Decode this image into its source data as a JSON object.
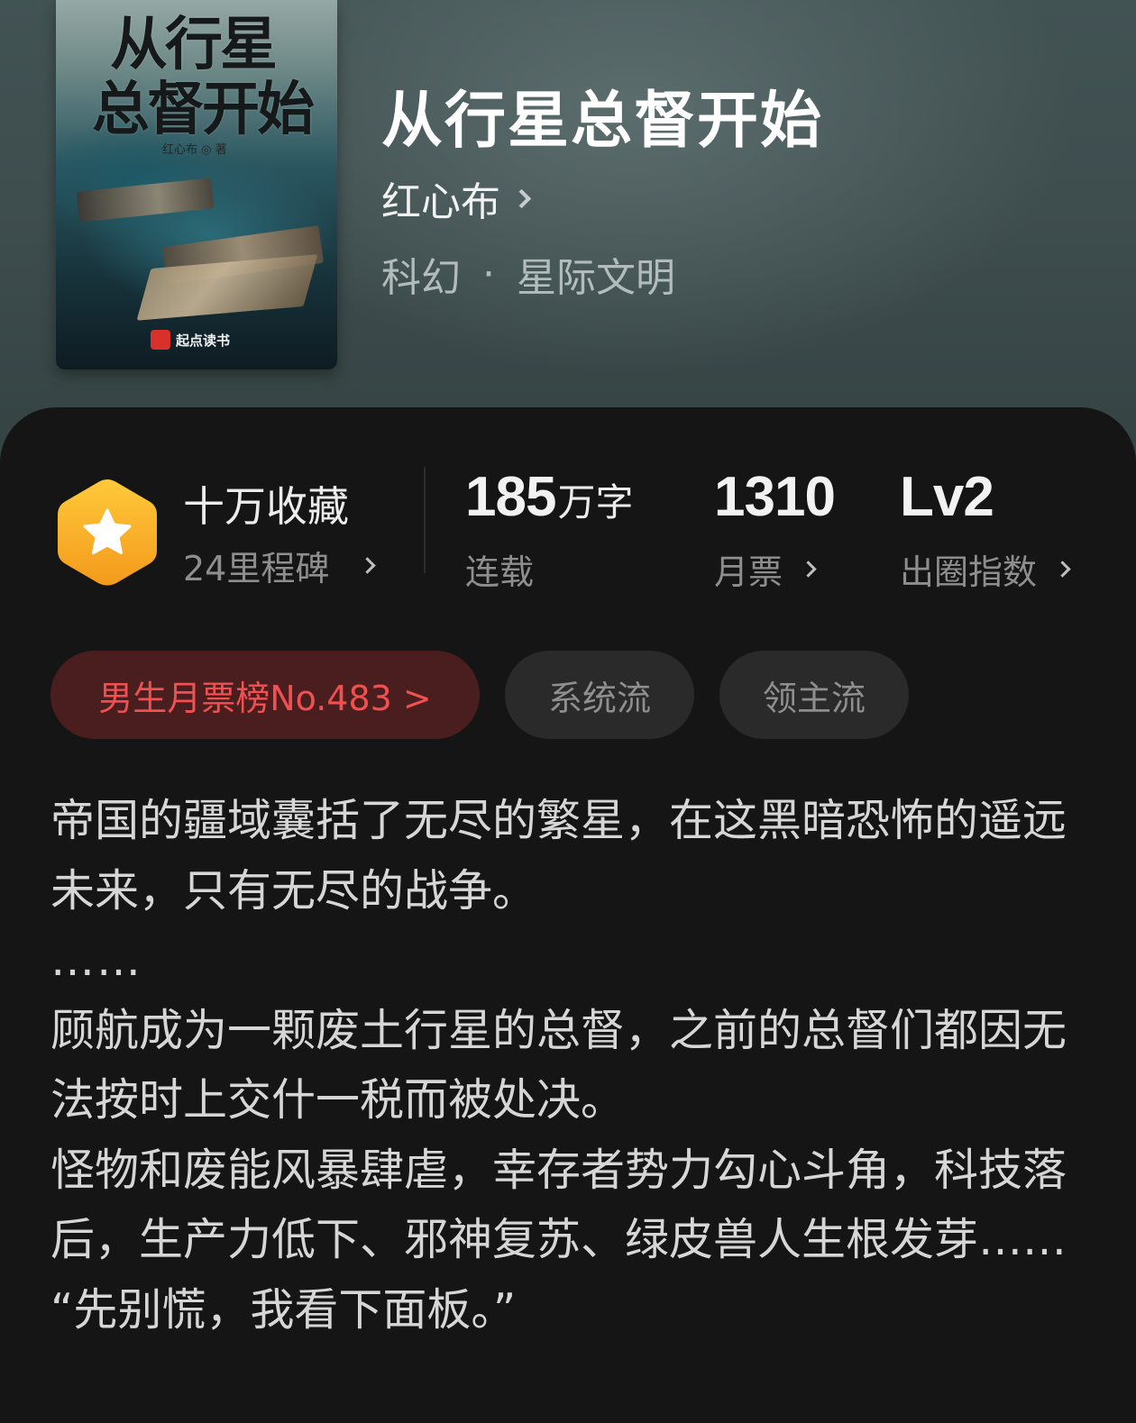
{
  "book": {
    "title": "从行星总督开始",
    "author": "红心布",
    "genre": "科幻",
    "genre_separator": "·",
    "subgenre": "星际文明",
    "cover": {
      "title_line1": "从行星",
      "title_line2": "总督开始",
      "author_credit": "红心布 ◎ 著",
      "publisher": "起点读书"
    }
  },
  "stats": {
    "collection_title": "十万收藏",
    "milestone": "24里程碑",
    "word_count_number": "185",
    "word_count_unit": "万字",
    "status": "连载",
    "monthly_tickets": "1310",
    "monthly_tickets_label": "月票",
    "level": "Lv2",
    "level_label": "出圈指数"
  },
  "tags": {
    "rank": "男生月票榜No.483 >",
    "tag1": "系统流",
    "tag2": "领主流"
  },
  "description": {
    "p1": "帝国的疆域囊括了无尽的繁星，在这黑暗恐怖的遥远未来，只有无尽的战争。",
    "p2": "……",
    "p3": "顾航成为一颗废土行星的总督，之前的总督们都因无法按时上交什一税而被处决。",
    "p4": "怪物和废能风暴肆虐，幸存者势力勾心斗角，科技落后，生产力低下、邪神复苏、绿皮兽人生根发芽……",
    "p5": "“先别慌，我看下面板。”"
  },
  "colors": {
    "header_bg": "#3e4d4e",
    "panel_bg": "#151515",
    "rank_bg": "#4a1e1e",
    "rank_text": "#f05050",
    "badge_orange": "#f7a928"
  },
  "icons": {
    "badge": "star-hexagon-icon",
    "chevron": "chevron-right-icon",
    "publisher_logo": "qidian-logo-icon"
  }
}
